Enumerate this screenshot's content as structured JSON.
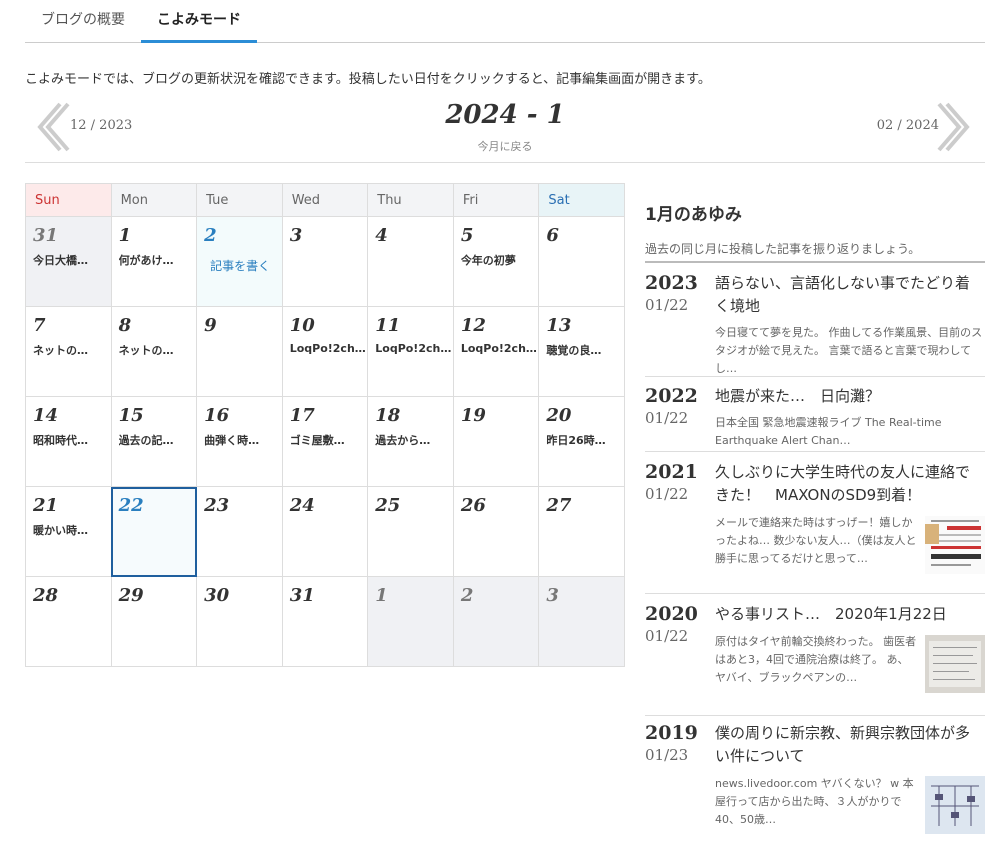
{
  "tabs": [
    {
      "label": "ブログの概要"
    },
    {
      "label": "こよみモード"
    }
  ],
  "description": "こよみモードでは、ブログの更新状況を確認できます。投稿したい日付をクリックすると、記事編集画面が開きます。",
  "nav": {
    "prev": "12 / 2023",
    "next": "02 / 2024",
    "current": "2024 - 1",
    "back": "今月に戻る"
  },
  "weekdays": [
    "Sun",
    "Mon",
    "Tue",
    "Wed",
    "Thu",
    "Fri",
    "Sat"
  ],
  "calendar": {
    "weeks": [
      [
        {
          "day": "31",
          "text": "今日大橋…"
        },
        {
          "day": "1",
          "text": "何があけ…"
        },
        {
          "day": "2",
          "text": "記事を書く"
        },
        {
          "day": "3",
          "text": ""
        },
        {
          "day": "4",
          "text": ""
        },
        {
          "day": "5",
          "text": "今年の初夢"
        },
        {
          "day": "6",
          "text": ""
        }
      ],
      [
        {
          "day": "7",
          "text": "ネットの…"
        },
        {
          "day": "8",
          "text": "ネットの…"
        },
        {
          "day": "9",
          "text": ""
        },
        {
          "day": "10",
          "text": "LoqPo!2ch…"
        },
        {
          "day": "11",
          "text": "LoqPo!2ch…"
        },
        {
          "day": "12",
          "text": "LoqPo!2ch…"
        },
        {
          "day": "13",
          "text": "聴覚の良…"
        }
      ],
      [
        {
          "day": "14",
          "text": "昭和時代…"
        },
        {
          "day": "15",
          "text": "過去の記…"
        },
        {
          "day": "16",
          "text": "曲弾く時…"
        },
        {
          "day": "17",
          "text": "ゴミ屋敷…"
        },
        {
          "day": "18",
          "text": "過去から…"
        },
        {
          "day": "19",
          "text": ""
        },
        {
          "day": "20",
          "text": "昨日26時…"
        }
      ],
      [
        {
          "day": "21",
          "text": "暖かい時…"
        },
        {
          "day": "22",
          "text": ""
        },
        {
          "day": "23",
          "text": ""
        },
        {
          "day": "24",
          "text": ""
        },
        {
          "day": "25",
          "text": ""
        },
        {
          "day": "26",
          "text": ""
        },
        {
          "day": "27",
          "text": ""
        }
      ],
      [
        {
          "day": "28",
          "text": ""
        },
        {
          "day": "29",
          "text": ""
        },
        {
          "day": "30",
          "text": ""
        },
        {
          "day": "31",
          "text": ""
        },
        {
          "day": "1",
          "text": ""
        },
        {
          "day": "2",
          "text": ""
        },
        {
          "day": "3",
          "text": ""
        }
      ]
    ]
  },
  "sidebar": {
    "title": "1月のあゆみ",
    "subtitle": "過去の同じ月に投稿した記事を振り返りましょう。",
    "articles": [
      {
        "year": "2023",
        "date": "01/22",
        "title": "語らない、言語化しない事でたどり着く境地",
        "excerpt": "今日寝てて夢を見た。 作曲してる作業風景、目前のスタジオが絵で見えた。 言葉で語ると言葉で現わしてし…"
      },
      {
        "year": "2022",
        "date": "01/22",
        "title": "地震が来た…　日向灘？",
        "excerpt": "日本全国 緊急地震速報ライブ The Real-time Earthquake Alert Chan…"
      },
      {
        "year": "2021",
        "date": "01/22",
        "title": "久しぶりに大学生時代の友人に連絡できた！　MAXONのSD9到着！",
        "excerpt": "メールで連絡来た時はすっげー！嬉しかったよね… 数少ない友人…（僕は友人と勝手に思ってるだけと思って…"
      },
      {
        "year": "2020",
        "date": "01/22",
        "title": "やる事リスト…　2020年1月22日",
        "excerpt": "原付はタイヤ前輪交換終わった。 歯医者はあと3，4回で通院治療は終了。 あ、ヤバイ、ブラックペアンの…"
      },
      {
        "year": "2019",
        "date": "01/23",
        "title": "僕の周りに新宗教、新興宗教団体が多い件について",
        "excerpt": "news.livedoor.com ヤバくない？ w 本屋行って店から出た時、３人がかりで40、50歳…"
      }
    ]
  }
}
